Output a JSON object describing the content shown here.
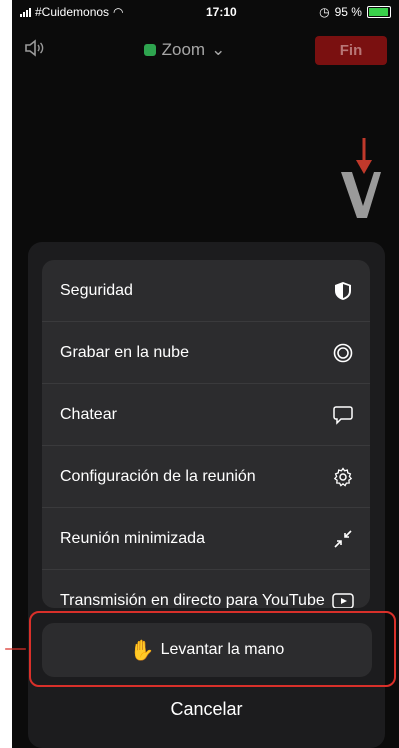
{
  "status_bar": {
    "carrier": "#Cuidemonos",
    "time": "17:10",
    "battery": "95 %",
    "battery_level_percent": 95
  },
  "header": {
    "speaker_icon": "speaker-icon",
    "title": "Zoom",
    "end_label": "Fin",
    "colors": {
      "end_bg": "#7a1010",
      "shield": "#2ea44f"
    }
  },
  "logo": {
    "letter": "V",
    "arrow_color": "#c0392b"
  },
  "menu": {
    "items": [
      {
        "label": "Seguridad",
        "icon": "shield-icon"
      },
      {
        "label": "Grabar en la nube",
        "icon": "cloud-record-icon"
      },
      {
        "label": "Chatear",
        "icon": "chat-icon"
      },
      {
        "label": "Configuración de la reunión",
        "icon": "gear-icon"
      },
      {
        "label": "Reunión minimizada",
        "icon": "minimize-icon"
      },
      {
        "label": "Transmisión en directo para YouTube",
        "icon": "youtube-icon"
      }
    ]
  },
  "raise_hand": {
    "label": "Levantar la mano",
    "icon": "hand-icon"
  },
  "cancel": {
    "label": "Cancelar"
  },
  "annotation": {
    "color": "#d9302a"
  }
}
